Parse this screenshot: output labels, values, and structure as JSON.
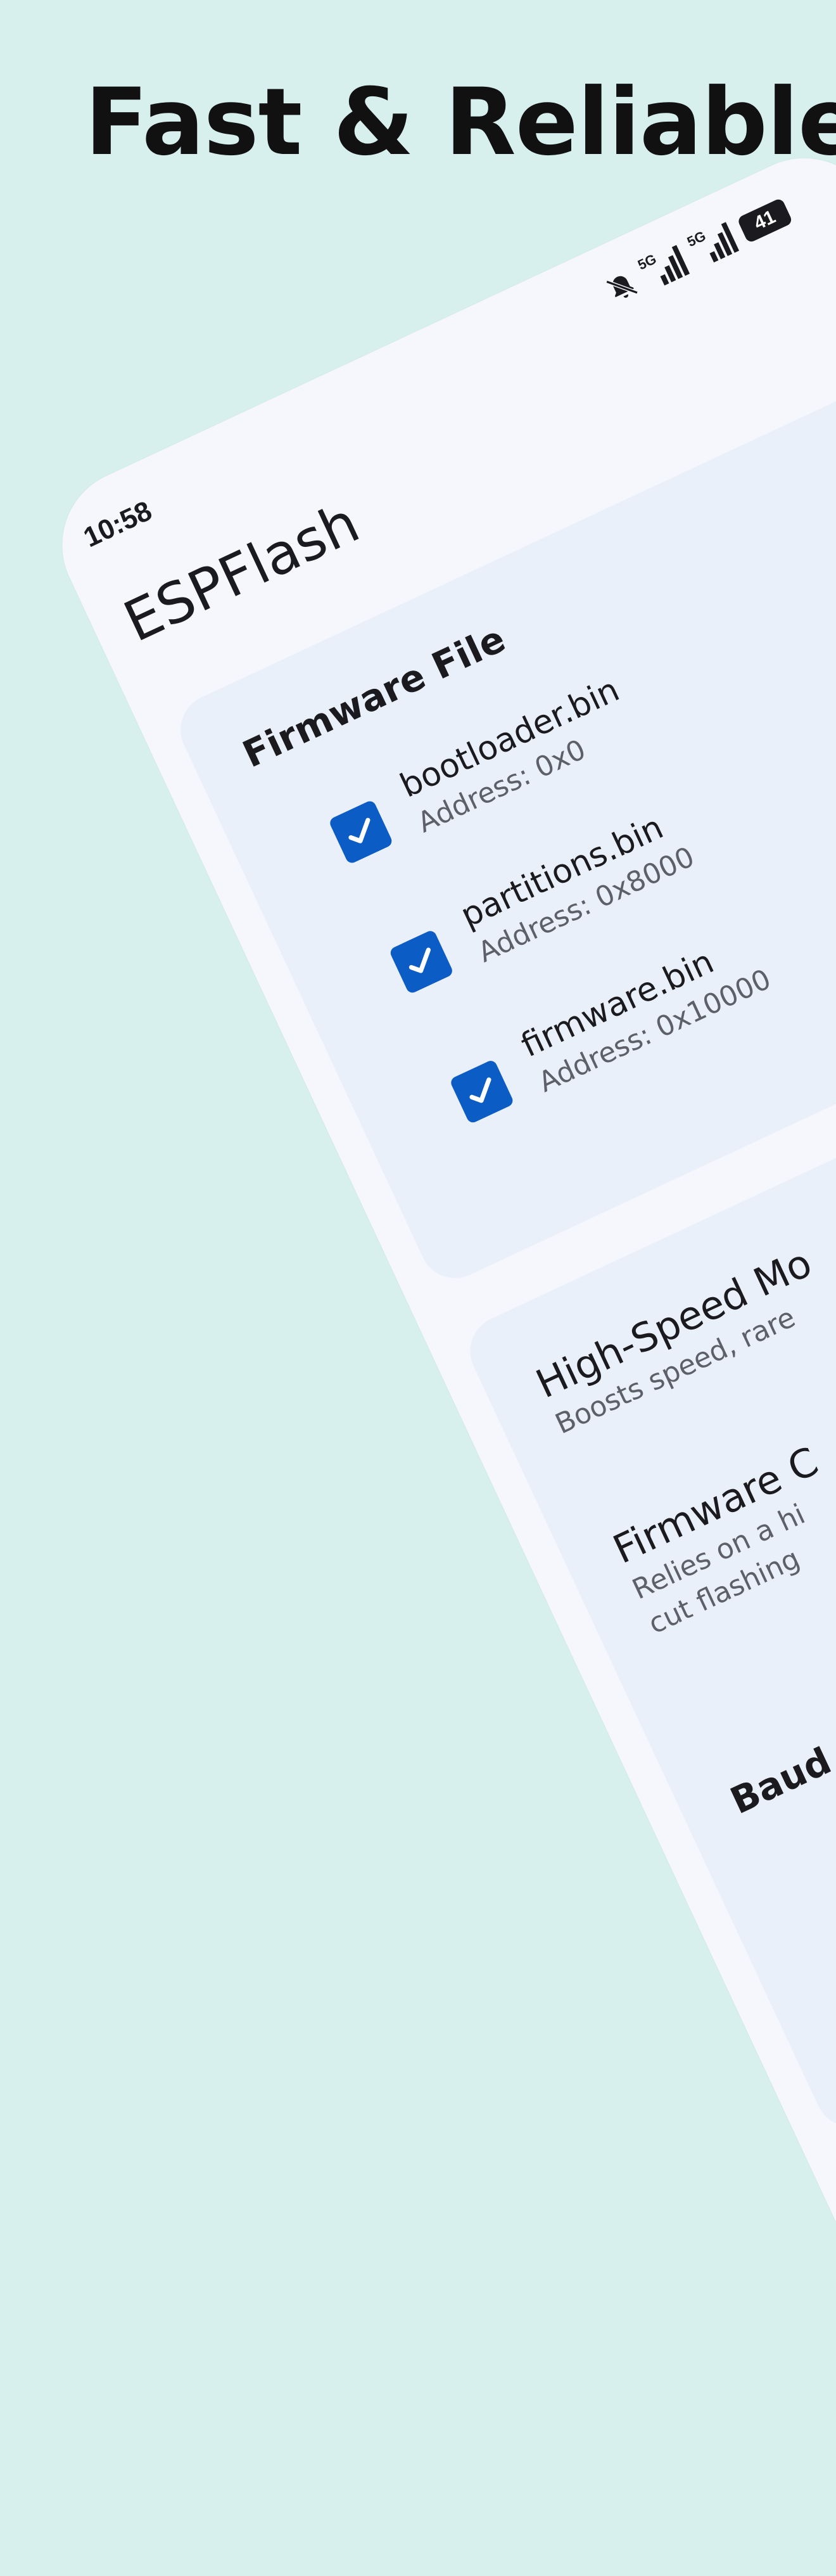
{
  "headline": "Fast & Reliable",
  "status_bar": {
    "time": "10:58",
    "network_1": "5G",
    "network_2": "5G",
    "battery": "41"
  },
  "app": {
    "title": "ESPFlash"
  },
  "firmware_card": {
    "title": "Firmware File",
    "files": [
      {
        "name": "bootloader.bin",
        "address": "Address: 0x0",
        "checked": true
      },
      {
        "name": "partitions.bin",
        "address": "Address: 0x8000",
        "checked": true
      },
      {
        "name": "firmware.bin",
        "address": "Address: 0x10000",
        "checked": true
      }
    ]
  },
  "options_card": {
    "high_speed": {
      "title": "High-Speed Mo",
      "desc": "Boosts speed, rare"
    },
    "firmware_check": {
      "title": "Firmware C",
      "desc_1": "Relies on a hi",
      "desc_2": "cut flashing"
    },
    "baud_label": "Baud"
  },
  "colors": {
    "background": "#d7efed",
    "phone_surface": "#f6f7fd",
    "card": "#eaf0fa",
    "checkbox": "#0b5cc4"
  }
}
